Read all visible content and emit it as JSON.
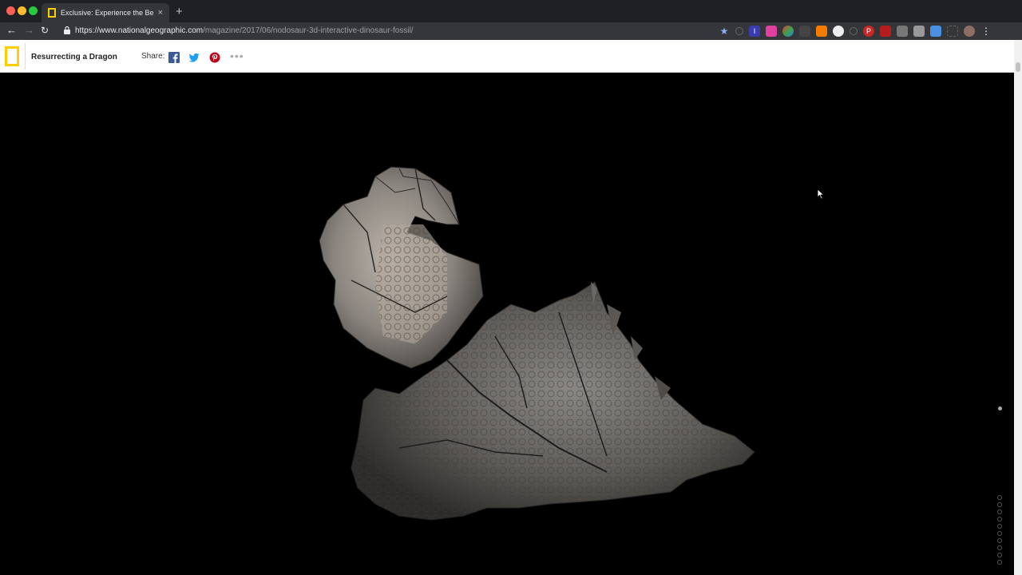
{
  "browser": {
    "tab_title": "Exclusive: Experience the Best",
    "tab_close": "×",
    "new_tab": "+",
    "url_host": "https://www.nationalgeographic.com",
    "url_path": "/magazine/2017/06/nodosaur-3d-interactive-dinosaur-fossil/"
  },
  "header": {
    "title": "Resurrecting a Dragon",
    "share_label": "Share:",
    "more": "•••"
  },
  "colors": {
    "brand_yellow": "#ffce00",
    "facebook": "#3b5998",
    "twitter": "#1da1f2",
    "pinterest": "#bd081c"
  },
  "viewer": {
    "step_count": 10
  }
}
